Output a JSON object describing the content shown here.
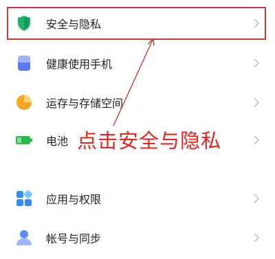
{
  "settings_items": [
    {
      "label": "安全与隐私",
      "icon": "shield-icon"
    },
    {
      "label": "健康使用手机",
      "icon": "hourglass-icon"
    },
    {
      "label": "运存与存储空间",
      "icon": "pie-chart-icon"
    },
    {
      "label": "电池",
      "icon": "battery-icon"
    },
    {
      "label": "应用与权限",
      "icon": "apps-grid-icon"
    },
    {
      "label": "帐号与同步",
      "icon": "person-icon"
    }
  ],
  "annotation": {
    "text": "点击安全与隐私",
    "color": "#e8231f"
  },
  "colors": {
    "highlight_border": "#c83a3a",
    "shield_green": "#1fb36c",
    "hourglass_blue": "#5b7cf5",
    "pie_orange": "#f5a623",
    "battery_green": "#2db84d",
    "apps_blue": "#2f8cf0",
    "person_blue": "#5b8ef5"
  }
}
